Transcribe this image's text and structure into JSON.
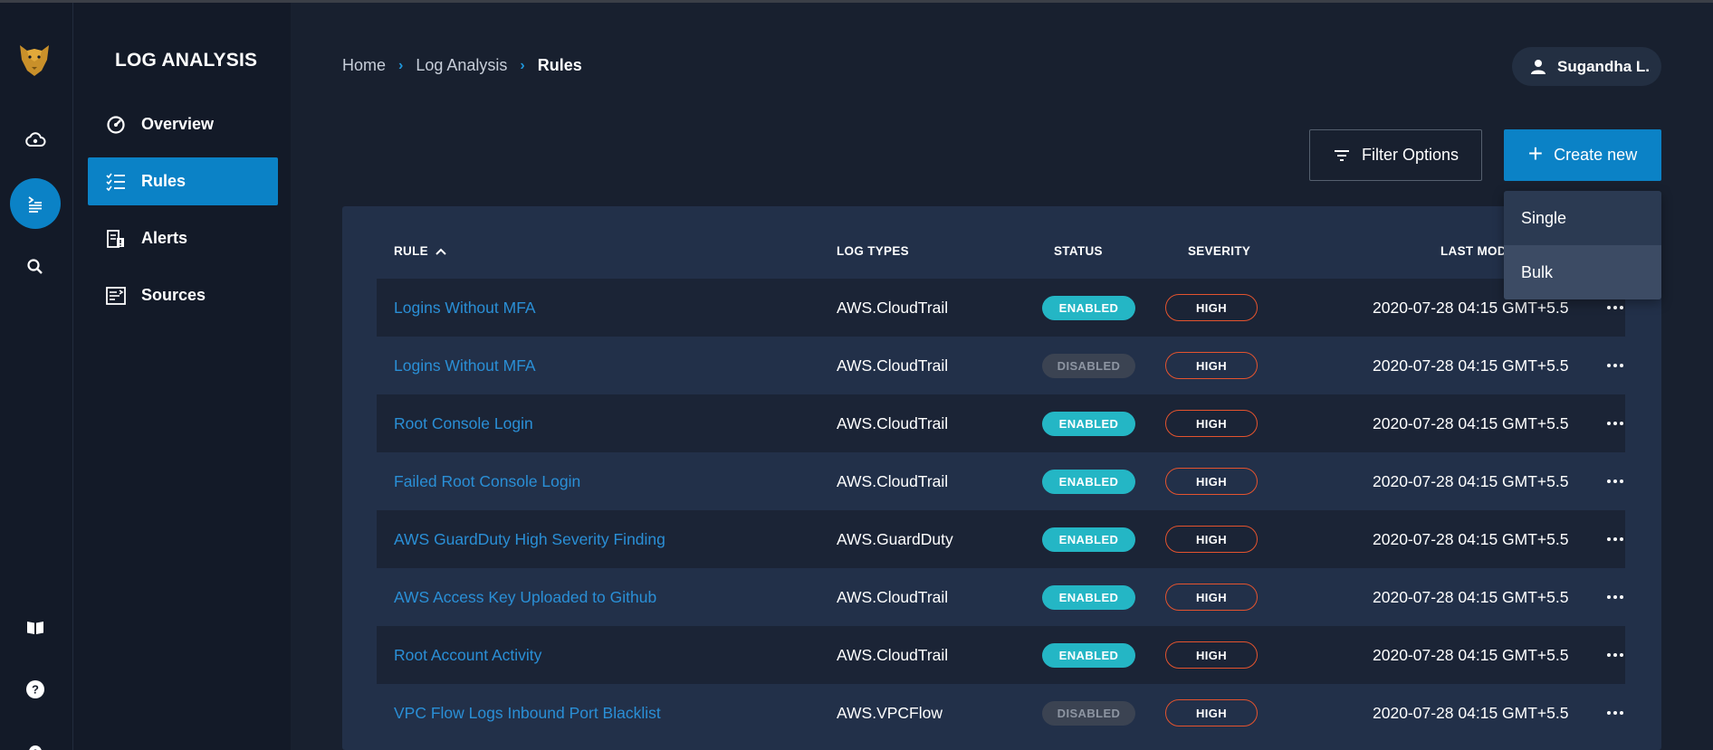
{
  "app": {
    "section_title": "LOG ANALYSIS",
    "colors": {
      "accent": "#0b82c6",
      "link": "#2a8fd6",
      "enabled": "#24b6c5",
      "severity_high_border": "#e4532e"
    }
  },
  "rail": {
    "items": [
      {
        "icon": "panther-logo-icon"
      },
      {
        "icon": "cloud-security-icon"
      },
      {
        "icon": "log-analysis-icon",
        "active": true
      },
      {
        "icon": "search-icon"
      },
      {
        "icon": "docs-book-icon"
      },
      {
        "icon": "help-icon"
      },
      {
        "icon": "settings-gear-icon"
      }
    ]
  },
  "subnav": {
    "items": [
      {
        "label": "Overview",
        "icon": "gauge-icon"
      },
      {
        "label": "Rules",
        "icon": "checklist-icon",
        "active": true
      },
      {
        "label": "Alerts",
        "icon": "alerts-icon"
      },
      {
        "label": "Sources",
        "icon": "sources-icon"
      }
    ]
  },
  "breadcrumb": {
    "items": [
      "Home",
      "Log Analysis",
      "Rules"
    ],
    "separator": "›"
  },
  "user": {
    "name": "Sugandha L."
  },
  "toolbar": {
    "filter_label": "Filter Options",
    "create_label": "Create new",
    "create_plus": "+"
  },
  "create_menu": {
    "items": [
      "Single",
      "Bulk"
    ]
  },
  "table": {
    "columns": {
      "rule": "RULE",
      "log_types": "LOG TYPES",
      "status": "STATUS",
      "severity": "SEVERITY",
      "last_modified": "LAST MOD"
    },
    "sort_indicator": "^",
    "rows": [
      {
        "name": "Logins Without MFA",
        "log_type": "AWS.CloudTrail",
        "status": "ENABLED",
        "severity": "HIGH",
        "modified": "2020-07-28 04:15 GMT+5.5"
      },
      {
        "name": "Logins Without MFA",
        "log_type": "AWS.CloudTrail",
        "status": "DISABLED",
        "severity": "HIGH",
        "modified": "2020-07-28 04:15 GMT+5.5"
      },
      {
        "name": "Root Console Login",
        "log_type": "AWS.CloudTrail",
        "status": "ENABLED",
        "severity": "HIGH",
        "modified": "2020-07-28 04:15 GMT+5.5"
      },
      {
        "name": "Failed Root Console Login",
        "log_type": "AWS.CloudTrail",
        "status": "ENABLED",
        "severity": "HIGH",
        "modified": "2020-07-28 04:15 GMT+5.5"
      },
      {
        "name": "AWS GuardDuty High Severity Finding",
        "log_type": "AWS.GuardDuty",
        "status": "ENABLED",
        "severity": "HIGH",
        "modified": "2020-07-28 04:15 GMT+5.5"
      },
      {
        "name": "AWS Access Key Uploaded to Github",
        "log_type": "AWS.CloudTrail",
        "status": "ENABLED",
        "severity": "HIGH",
        "modified": "2020-07-28 04:15 GMT+5.5"
      },
      {
        "name": "Root Account Activity",
        "log_type": "AWS.CloudTrail",
        "status": "ENABLED",
        "severity": "HIGH",
        "modified": "2020-07-28 04:15 GMT+5.5"
      },
      {
        "name": "VPC Flow Logs Inbound Port Blacklist",
        "log_type": "AWS.VPCFlow",
        "status": "DISABLED",
        "severity": "HIGH",
        "modified": "2020-07-28 04:15 GMT+5.5"
      }
    ]
  }
}
